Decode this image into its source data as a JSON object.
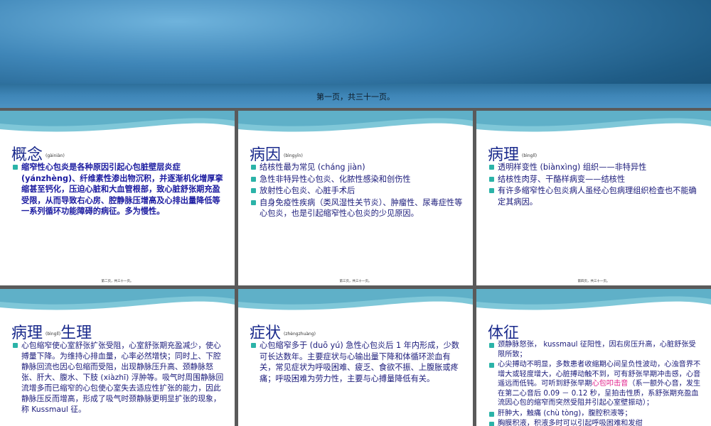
{
  "main_slide": {
    "caption": "第一页，共三十一页。"
  },
  "slides": [
    {
      "title": "概念",
      "title_py": "(gàiniàn)",
      "items": [
        "缩窄性心包炎是各种原因引起心包脏壁层炎症(yánzhèng)、纤维素性渗出物沉积，并逐渐机化增厚挛缩甚至钙化，压迫心脏和大血管根部，致心脏舒张期充盈受限，从而导致右心房、腔静脉压增高及心排出量降低等一系列循环功能障碍的病征。多为慢性。"
      ],
      "footer": "第二页，共三十一页。"
    },
    {
      "title": "病因",
      "title_py": "(bìngyīn)",
      "items": [
        "结核性最为常见 (cháng jiàn)",
        "急性非特异性心包炎、化脓性感染和创伤性",
        "放射性心包炎、心脏手术后",
        "自身免疫性疾病（类风湿性关节炎）、肿瘤性、尿毒症性等心包炎，也是引起缩窄性心包炎的少见原因。"
      ],
      "footer": "第三页，共三十一页。"
    },
    {
      "title": "病理",
      "title_py": "(bìnglǐ)",
      "items": [
        "透明样变性 (biànxìng) 组织——非特异性",
        "结核性肉芽、干酪样病变——结核性",
        "有许多缩窄性心包炎病人虽经心包病理组织检查也不能确定其病因。"
      ],
      "footer": "第四页，共三十一页。"
    },
    {
      "title": "病理",
      "title_py": "(bìnglǐ)",
      "title2": "生理",
      "items": [
        "心包缩窄使心室舒张扩张受阻，心室舒张期充盈减少，使心搏量下降。为维持心排血量，心率必然增快；同时上、下腔静脉回流也因心包缩而受阻，出现静脉压升高、颈静脉怒张、肝大、腹水、下肢 (xiàzhī) 浮肿等。吸气时周围静脉回流增多而已缩窄的心包使心室失去适应性扩张的能力，因此静脉压反而增高，形成了吸气时颈静脉更明显扩张的现象，称 Kussmaul 征。"
      ],
      "footer": ""
    },
    {
      "title": "症状",
      "title_py": "(zhèngzhuàng)",
      "items": [
        "心包缩窄多于 (duō yú) 急性心包炎后 1 年内形成，少数可长达数年。主要症状与心输出量下降和体循环淤血有关，常见症状为呼吸困难、疲乏、食欲不振、上腹胀或疼痛；呼吸困难为劳力性，主要与心搏量降低有关。"
      ],
      "footer": ""
    },
    {
      "title": "体征",
      "title_py": "",
      "items": [
        "颈静脉怒张， kussmaul 征阳性，因右房压升高，心脏舒张受限所致；",
        "心尖搏动不明显，多数患者收缩期心间呈负性波动，心浊音界不增大或轻度增大，心脏搏动触不到，可有舒张早期冲击感，心音遥远而低钝。可听到舒张早期",
        "肝肿大，触痛 (chù tòng)，腹腔积液等；",
        "胸膜积液，积液多时可以引起呼吸困难和发绀"
      ],
      "knock": "心包叩击音",
      "knock_rest": "（系一额外心音，发生在第二心音后 0.09 － 0.12 秒，呈拍击性质，系舒张期充盈血流因心包的缩窄而突然受阻并引起心室壁振动）；",
      "footer": ""
    }
  ]
}
